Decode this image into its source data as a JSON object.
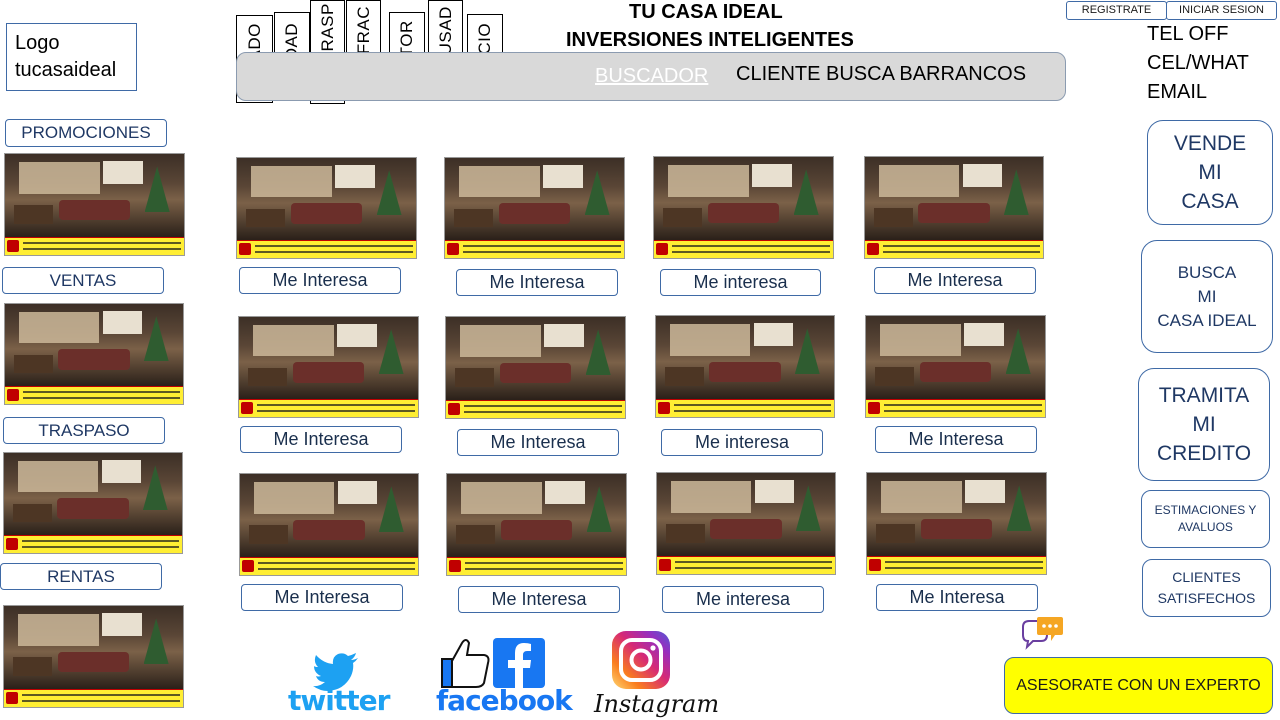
{
  "logo": {
    "line1": "Logo",
    "line2": "tucasaideal"
  },
  "filters": [
    "ESTADO",
    "CIUDAD",
    "VTA\\TRASP",
    "COL\\FRAC",
    "SECTOR",
    "NVA\\USAD",
    "PRECIO"
  ],
  "header": {
    "title1": "TU CASA IDEAL",
    "title2": "INVERSIONES INTELIGENTES"
  },
  "search": {
    "link": "BUSCADOR",
    "text": "CLIENTE BUSCA BARRANCOS"
  },
  "auth": {
    "register": "REGISTRATE",
    "login": "INICIAR SESION"
  },
  "contact": {
    "line1": "TEL OFF",
    "line2": "CEL/WHAT",
    "line3": "EMAIL"
  },
  "categories": {
    "promociones": "PROMOCIONES",
    "ventas": "VENTAS",
    "traspaso": "TRASPASO",
    "rentas": "RENTAS"
  },
  "side_buttons": {
    "vende": "VENDE\nMI\nCASA",
    "busca": "BUSCA\nMI\nCASA IDEAL",
    "tramita": "TRAMITA\nMI\nCREDITO",
    "estimaciones": "ESTIMACIONES Y\nAVALUOS",
    "clientes": "CLIENTES\nSATISFECHOS"
  },
  "listing_buttons": [
    [
      "Me Interesa",
      "Me Interesa",
      "Me interesa",
      "Me Interesa"
    ],
    [
      "Me Interesa",
      "Me Interesa",
      "Me interesa",
      "Me Interesa"
    ],
    [
      "Me Interesa",
      "Me Interesa",
      "Me interesa",
      "Me Interesa"
    ]
  ],
  "social": {
    "twitter": "twitter",
    "facebook": "facebook",
    "instagram": "Instagram"
  },
  "cta": {
    "experto": "ASESORATE CON UN EXPERTO"
  },
  "colors": {
    "accent": "#3f6aa6",
    "cta": "#ffff00",
    "twitter": "#1da1f2",
    "facebook": "#1877f2"
  }
}
